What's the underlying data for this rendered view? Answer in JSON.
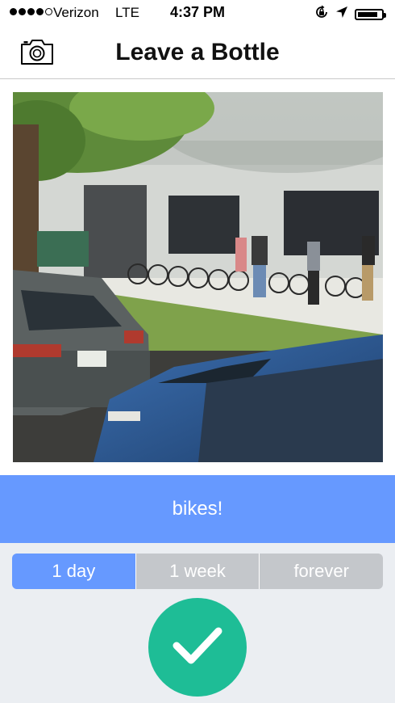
{
  "status_bar": {
    "carrier": "Verizon",
    "network": "LTE",
    "time": "4:37 PM",
    "signal_bars": 4,
    "signal_total": 5,
    "icons": [
      "orientation-lock-icon",
      "location-arrow-icon",
      "battery-icon"
    ]
  },
  "header": {
    "title": "Leave a Bottle",
    "left_icon": "camera-icon"
  },
  "photo": {
    "subject": "photo"
  },
  "caption": {
    "text": "bikes!"
  },
  "duration": {
    "options": [
      "1 day",
      "1 week",
      "forever"
    ],
    "selected": "1 day"
  },
  "confirm": {
    "icon": "checkmark-icon"
  },
  "colors": {
    "accent": "#6699ff",
    "confirm": "#1ebd96",
    "segment_inactive": "#c4c7cb",
    "background": "#ebeef2"
  }
}
